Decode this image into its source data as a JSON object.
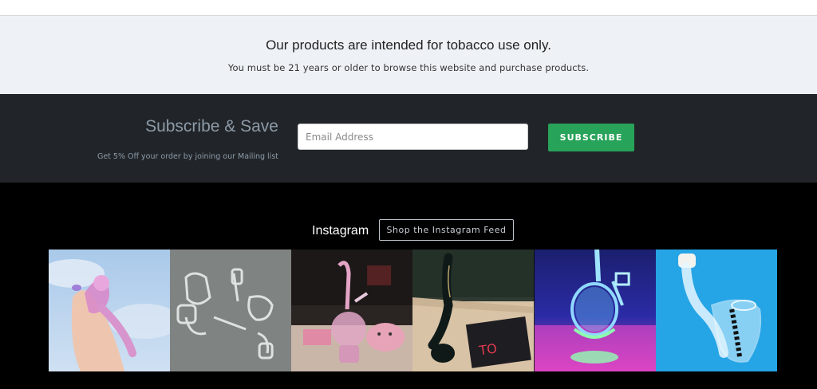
{
  "notice": {
    "title": "Our products are intended for tobacco use only.",
    "subtitle": "You must be 21 years or older to browse this website and purchase products."
  },
  "subscribe": {
    "title": "Subscribe & Save",
    "description": "Get 5% Off your order by joining our Mailing list",
    "email_placeholder": "Email Address",
    "button_label": "SUBSCRIBE",
    "button_color": "#28a35a",
    "background": "#212529"
  },
  "instagram": {
    "label": "Instagram",
    "button_label": "Shop the Instagram Feed",
    "tiles": [
      {
        "name": "pink-spoon-pipe-photo"
      },
      {
        "name": "glass-bangers-photo"
      },
      {
        "name": "pink-recycler-rig-photo"
      },
      {
        "name": "black-sherlock-pipe-photo"
      },
      {
        "name": "neon-recycler-rig-photo"
      },
      {
        "name": "clear-bubbler-photo"
      }
    ]
  }
}
